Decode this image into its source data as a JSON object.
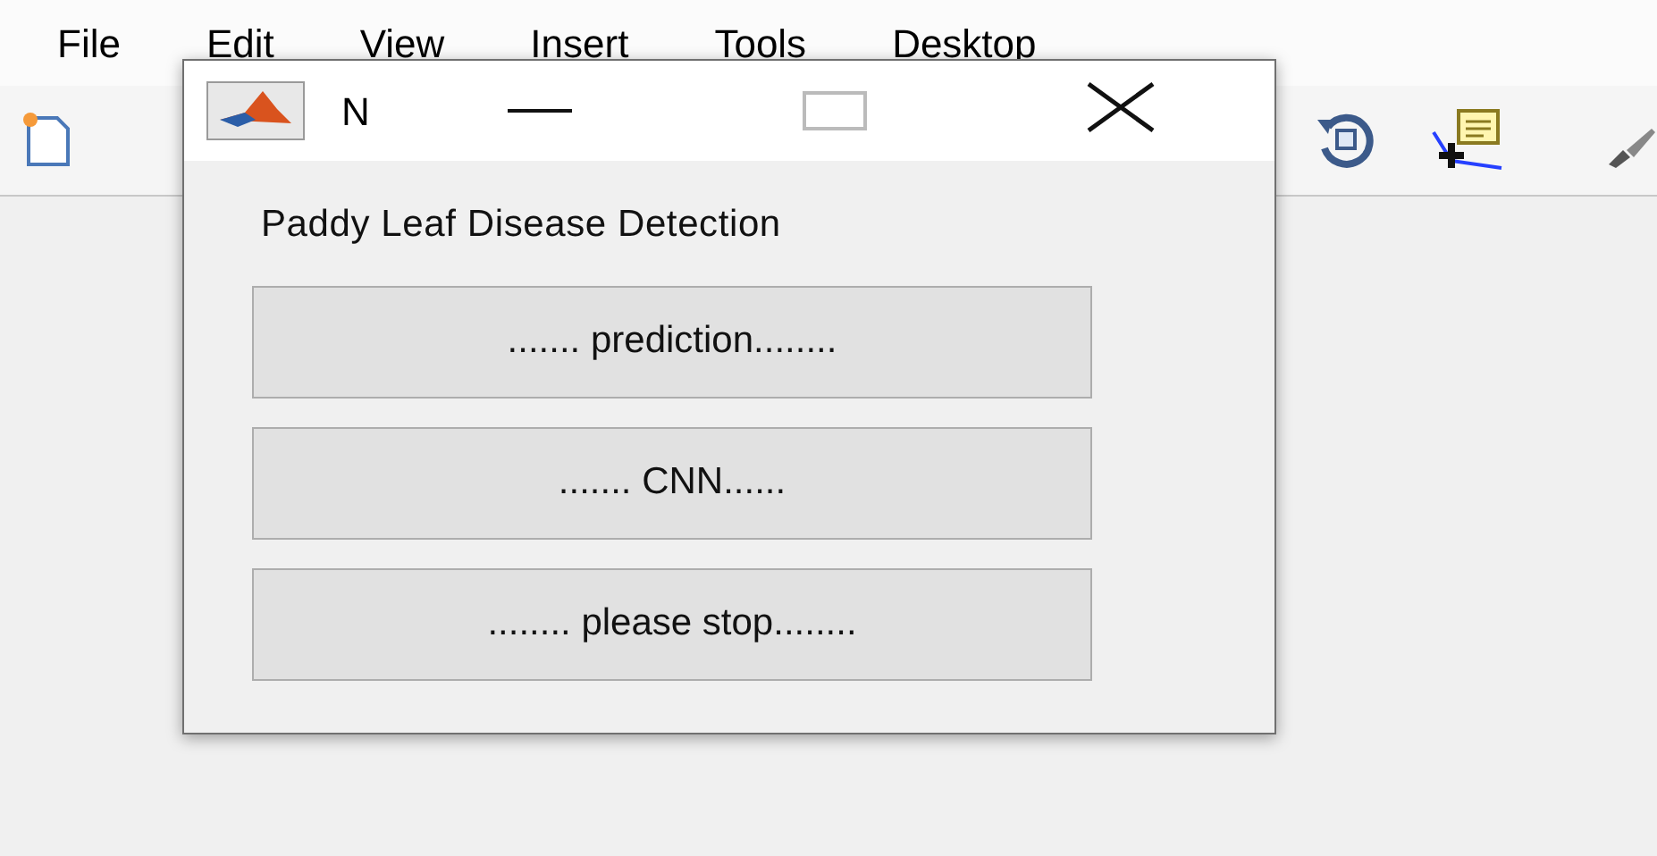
{
  "menu_bar": [
    "File",
    "Edit",
    "View",
    "Insert",
    "Tools",
    "Desktop"
  ],
  "dialog": {
    "title": "N",
    "heading": "Paddy Leaf Disease Detection",
    "buttons": [
      "....... prediction........",
      "....... CNN......",
      "........ please stop........"
    ]
  }
}
